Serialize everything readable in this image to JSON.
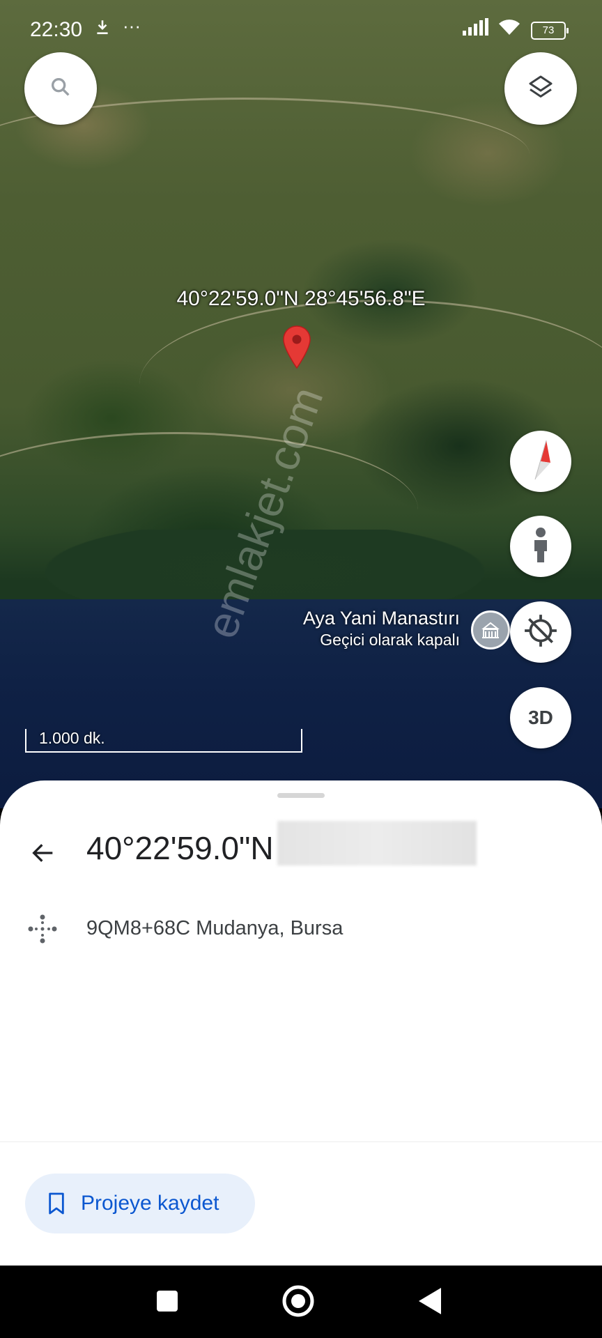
{
  "status_bar": {
    "time": "22:30",
    "battery": "73",
    "icons": [
      "download-icon",
      "more-icon",
      "signal-icon",
      "wifi-icon",
      "battery-icon"
    ]
  },
  "map": {
    "pin_coordinates": "40°22'59.0\"N 28°45'56.8\"E",
    "poi": {
      "name": "Aya Yani Manastırı",
      "status": "Geçici olarak kapalı",
      "icon": "landmark-icon"
    },
    "scale_label": "1.000 dk.",
    "watermark": "emlakjet.com",
    "controls": {
      "search_icon": "search-icon",
      "layers_icon": "layers-icon",
      "compass_icon": "compass-icon",
      "street_view_icon": "street-view-icon",
      "location_icon": "location-off-icon",
      "three_d_label": "3D"
    }
  },
  "sheet": {
    "title": "40°22'59.0\"N",
    "plus_code": "9QM8+68C Mudanya, Bursa",
    "save_button_label": "Projeye kaydet"
  },
  "colors": {
    "accent": "#0b57d0",
    "pin": "#e53935",
    "save_bg": "#e8f0fb"
  }
}
